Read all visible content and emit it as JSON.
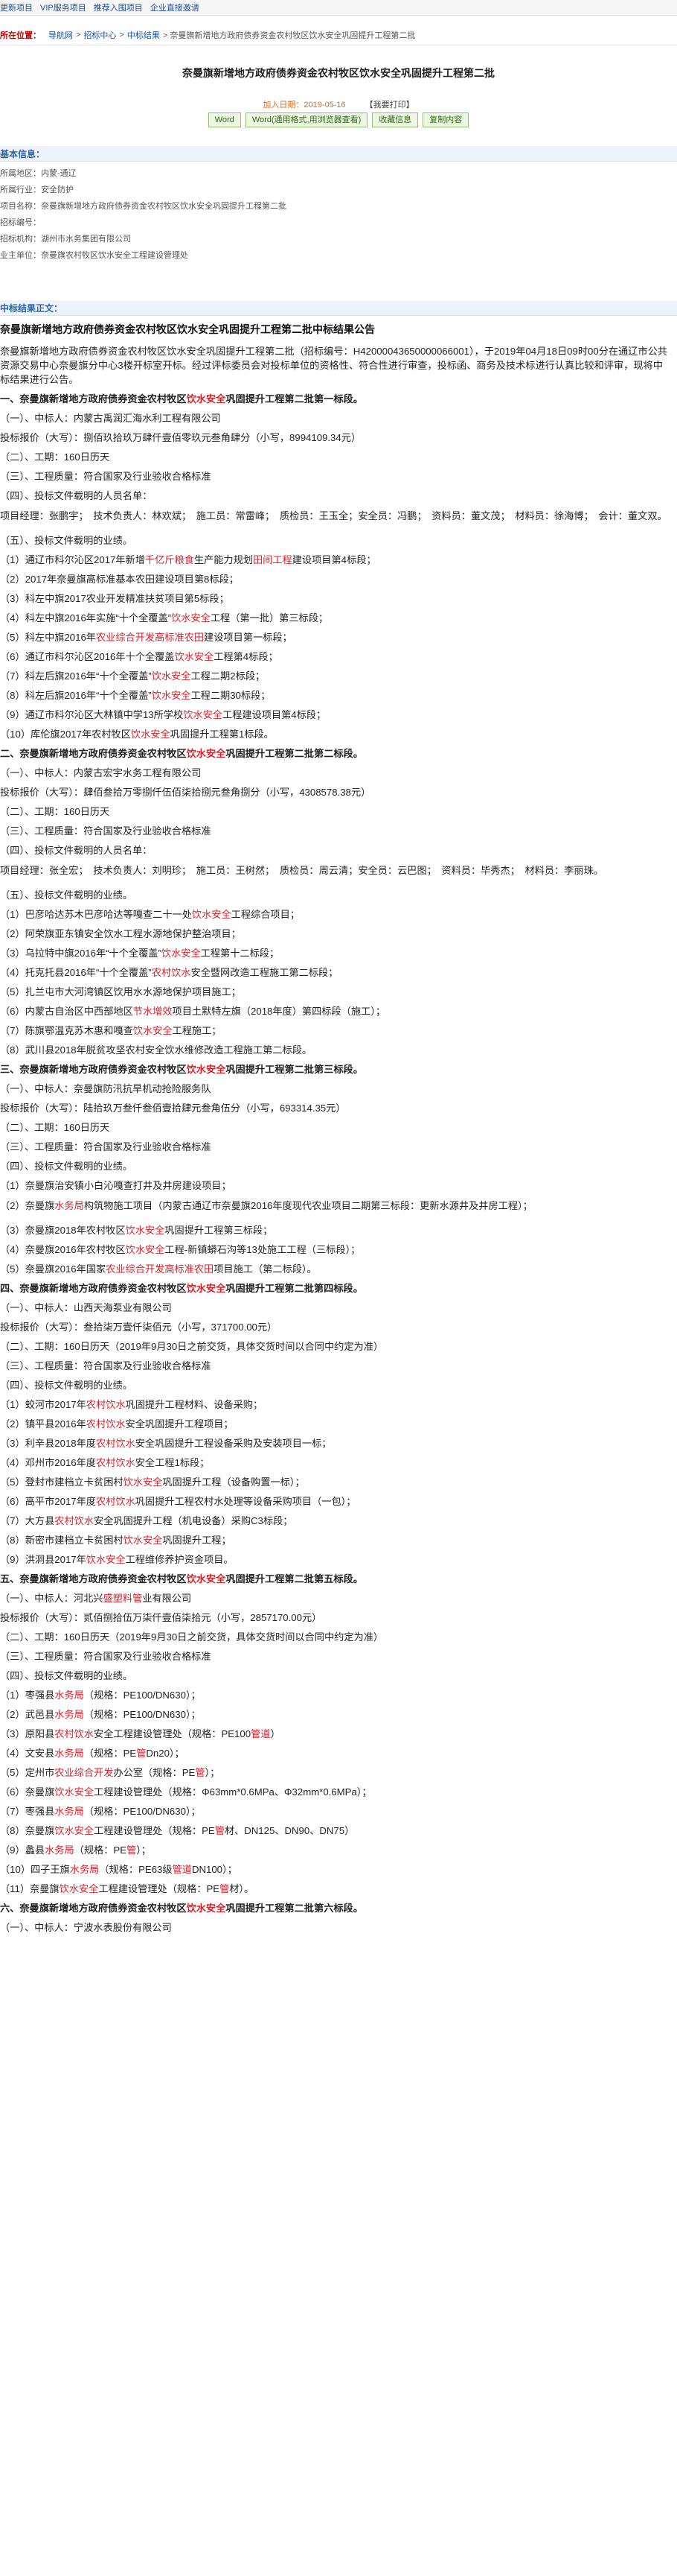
{
  "topbar": [
    "更新项目",
    "VIP服务项目",
    "推荐入围项目",
    "企业直接邀请"
  ],
  "breadcrumb": {
    "label": "所在位置：",
    "items": [
      "导航网",
      "招标中心",
      "中标结果"
    ],
    "sep": ">",
    "current": "> 奈曼旗新增地方政府债券资金农村牧区饮水安全巩固提升工程第二批"
  },
  "title": "奈曼旗新增地方政府债券资金农村牧区饮水安全巩固提升工程第二批",
  "meta": {
    "date": "加入日期：2019-05-16",
    "print": "【我要打印】"
  },
  "buttons": [
    "Word",
    "Word(通用格式,用浏览器查看)",
    "收藏信息",
    "复制内容"
  ],
  "basic_info": {
    "header": "基本信息：",
    "rows": [
      "所属地区：内蒙-通辽",
      "所属行业：安全防护",
      "项目名称：奈曼旗新增地方政府债券资金农村牧区饮水安全巩固提升工程第二批",
      "招标编号：",
      "招标机构：湖州市水务集团有限公司",
      "业主单位：奈曼旗农村牧区饮水安全工程建设管理处"
    ]
  },
  "body_header": "中标结果正文：",
  "article": {
    "title": "奈曼旗新增地方政府债券资金农村牧区饮水安全巩固提升工程第二批中标结果公告",
    "lines": [
      {
        "kind": "wrap",
        "segs": [
          "奈曼旗新增地方政府债券资金农村牧区饮水安全巩固提升工程第二批（招标编号：H42000043650000066001），于2019年04月18日09时00分在通辽市公共资源交易中心奈曼旗分中心3楼开标室开标。经过评标委员会对投标单位的资格性、符合性进行审查，投标函、商务及技术标进行认真比较和评审，现将中标结果进行公告。"
        ]
      },
      {
        "kind": "bold",
        "segs": [
          "一、奈曼旗新增地方政府债券资金农村牧区",
          "饮水安全",
          "巩固提升工程第二批第一标段。"
        ]
      },
      {
        "kind": "plain",
        "segs": [
          "（一）、中标人：内蒙古禹润汇海水利工程有限公司"
        ]
      },
      {
        "kind": "plain",
        "segs": [
          "投标报价（大写）：捌佰玖拾玖万肆仟壹佰零玖元叁角肆分（小写，8994109.34元）"
        ]
      },
      {
        "kind": "plain",
        "segs": [
          "（二）、工期：160日历天"
        ]
      },
      {
        "kind": "plain",
        "segs": [
          "（三）、工程质量：符合国家及行业验收合格标准"
        ]
      },
      {
        "kind": "plain",
        "segs": [
          "（四）、投标文件载明的人员名单："
        ]
      },
      {
        "kind": "wrap",
        "segs": [
          "项目经理：张鹏宇；　技术负责人：林欢斌；　施工员：常雷峰；　质检员：王玉全；安全员：冯鹏；　资料员：董文茂；　材料员：徐海博；　会计：董文双。"
        ]
      },
      {
        "kind": "plain",
        "segs": [
          "（五）、投标文件载明的业绩。"
        ]
      },
      {
        "kind": "plain",
        "segs": [
          "（1）通辽市科尔沁区2017年新增",
          "千亿斤粮食",
          "生产能力规划",
          "田间工程",
          "建设项目第4标段；"
        ]
      },
      {
        "kind": "plain",
        "segs": [
          "（2）2017年奈曼旗高标准基本农田建设项目第8标段；"
        ]
      },
      {
        "kind": "plain",
        "segs": [
          "（3）科左中旗2017农业开发精准扶贫项目第5标段；"
        ]
      },
      {
        "kind": "plain",
        "segs": [
          "（4）科左中旗2016年实施“十个全覆盖”",
          "饮水安全",
          "工程（第一批）第三标段；"
        ]
      },
      {
        "kind": "plain",
        "segs": [
          "（5）科左中旗2016年",
          "农业综合开发高标准农田",
          "建设项目第一标段；"
        ]
      },
      {
        "kind": "plain",
        "segs": [
          "（6）通辽市科尔沁区2016年十个全覆盖",
          "饮水安全",
          "工程第4标段；"
        ]
      },
      {
        "kind": "plain",
        "segs": [
          "（7）科左后旗2016年“十个全覆盖”",
          "饮水安全",
          "工程二期2标段；"
        ]
      },
      {
        "kind": "plain",
        "segs": [
          "（8）科左后旗2016年“十个全覆盖”",
          "饮水安全",
          "工程二期30标段；"
        ]
      },
      {
        "kind": "plain",
        "segs": [
          "（9）通辽市科尔沁区大林镇中学13所学校",
          "饮水安全",
          "工程建设项目第4标段；"
        ]
      },
      {
        "kind": "plain",
        "segs": [
          "（10）库伦旗2017年农村牧区",
          "饮水安全",
          "巩固提升工程第1标段。"
        ]
      },
      {
        "kind": "bold",
        "segs": [
          "二、奈曼旗新增地方政府债券资金农村牧区",
          "饮水安全",
          "巩固提升工程第二批第二标段。"
        ]
      },
      {
        "kind": "plain",
        "segs": [
          "（一）、中标人：内蒙古宏宇水务工程有限公司"
        ]
      },
      {
        "kind": "plain",
        "segs": [
          "投标报价（大写）：肆佰叁拾万零捌仟伍佰柒拾捌元叁角捌分（小写，4308578.38元）"
        ]
      },
      {
        "kind": "plain",
        "segs": [
          "（二）、工期：160日历天"
        ]
      },
      {
        "kind": "plain",
        "segs": [
          "（三）、工程质量：符合国家及行业验收合格标准"
        ]
      },
      {
        "kind": "plain",
        "segs": [
          "（四）、投标文件载明的人员名单："
        ]
      },
      {
        "kind": "wrap",
        "segs": [
          "项目经理：张全宏；　技术负责人：刘明珍；　施工员：王树然；　质检员：周云清；安全员：云巴图；　资料员：毕秀杰；　材料员：李丽珠。"
        ]
      },
      {
        "kind": "plain",
        "segs": [
          "（五）、投标文件载明的业绩。"
        ]
      },
      {
        "kind": "plain",
        "segs": [
          "（1）巴彦哈达苏木巴彦哈达等嘎查二十一处",
          "饮水安全",
          "工程综合项目；"
        ]
      },
      {
        "kind": "plain",
        "segs": [
          "（2）阿荣旗亚东镇安全饮水工程水源地保护整治项目；"
        ]
      },
      {
        "kind": "plain",
        "segs": [
          "（3）乌拉特中旗2016年“十个全覆盖”",
          "饮水安全",
          "工程第十二标段；"
        ]
      },
      {
        "kind": "plain",
        "segs": [
          "（4）托克托县2016年“十个全覆盖”",
          "农村饮水",
          "安全暨网改造工程施工第二标段；"
        ]
      },
      {
        "kind": "plain",
        "segs": [
          "（5）扎兰屯市大河湾镇区饮用水水源地保护项目施工；"
        ]
      },
      {
        "kind": "plain",
        "segs": [
          "（6）内蒙古自治区中西部地区",
          "节水增效",
          "项目土默特左旗（2018年度）第四标段（施工）；"
        ]
      },
      {
        "kind": "plain",
        "segs": [
          "（7）陈旗鄂温克苏木惠和嘎查",
          "饮水安全",
          "工程施工；"
        ]
      },
      {
        "kind": "plain",
        "segs": [
          "（8）武川县2018年脱贫攻坚农村安全饮水维修改造工程施工第二标段。"
        ]
      },
      {
        "kind": "bold",
        "segs": [
          "三、奈曼旗新增地方政府债券资金农村牧区",
          "饮水安全",
          "巩固提升工程第二批第三标段。"
        ]
      },
      {
        "kind": "plain",
        "segs": [
          "（一）、中标人：奈曼旗防汛抗旱机动抢险服务队"
        ]
      },
      {
        "kind": "plain",
        "segs": [
          "投标报价（大写）：陆拾玖万叁仟叁佰壹拾肆元叁角伍分（小写，693314.35元）"
        ]
      },
      {
        "kind": "plain",
        "segs": [
          "（二）、工期：160日历天"
        ]
      },
      {
        "kind": "plain",
        "segs": [
          "（三）、工程质量：符合国家及行业验收合格标准"
        ]
      },
      {
        "kind": "plain",
        "segs": [
          "（四）、投标文件载明的业绩。"
        ]
      },
      {
        "kind": "plain",
        "segs": [
          "（1）奈曼旗治安镇小白沁嘎查打井及井房建设项目；"
        ]
      },
      {
        "kind": "wrap",
        "segs": [
          "（2）奈曼旗",
          "水务局",
          "构筑物施工项目（内蒙古通辽市奈曼旗2016年度现代农业项目二期第三标段：更新水源井及井房工程）；"
        ]
      },
      {
        "kind": "plain",
        "segs": [
          "（3）奈曼旗2018年农村牧区",
          "饮水安全",
          "巩固提升工程第三标段；"
        ]
      },
      {
        "kind": "plain",
        "segs": [
          "（4）奈曼旗2016年农村牧区",
          "饮水安全",
          "工程-新镇蟒石沟等13处施工工程（三标段）；"
        ]
      },
      {
        "kind": "plain",
        "segs": [
          "（5）奈曼旗2016年国家",
          "农业综合开发高标准农田",
          "项目施工（第二标段）。"
        ]
      },
      {
        "kind": "bold",
        "segs": [
          "四、奈曼旗新增地方政府债券资金农村牧区",
          "饮水安全",
          "巩固提升工程第二批第四标段。"
        ]
      },
      {
        "kind": "plain",
        "segs": [
          "（一）、中标人：山西天海泵业有限公司"
        ]
      },
      {
        "kind": "plain",
        "segs": [
          "投标报价（大写）：叁拾柒万壹仟柒佰元（小写，371700.00元）"
        ]
      },
      {
        "kind": "plain",
        "segs": [
          "（二）、工期：160日历天（2019年9月30日之前交货，具体交货时间以合同中约定为准）"
        ]
      },
      {
        "kind": "plain",
        "segs": [
          "（三）、工程质量：符合国家及行业验收合格标准"
        ]
      },
      {
        "kind": "plain",
        "segs": [
          "（四）、投标文件载明的业绩。"
        ]
      },
      {
        "kind": "plain",
        "segs": [
          "（1）蛟河市2017年",
          "农村饮水",
          "巩固提升工程材料、设备采购；"
        ]
      },
      {
        "kind": "plain",
        "segs": [
          "（2）镇平县2016年",
          "农村饮水",
          "安全巩固提升工程项目；"
        ]
      },
      {
        "kind": "plain",
        "segs": [
          "（3）利辛县2018年度",
          "农村饮水",
          "安全巩固提升工程设备采购及安装项目一标；"
        ]
      },
      {
        "kind": "plain",
        "segs": [
          "（4）邓州市2016年度",
          "农村饮水",
          "安全工程1标段；"
        ]
      },
      {
        "kind": "plain",
        "segs": [
          "（5）登封市建档立卡贫困村",
          "饮水安全",
          "巩固提升工程（设备购置一标）；"
        ]
      },
      {
        "kind": "plain",
        "segs": [
          "（6）高平市2017年度",
          "农村饮水",
          "巩固提升工程农村水处理等设备采购项目（一包）；"
        ]
      },
      {
        "kind": "plain",
        "segs": [
          "（7）大方县",
          "农村饮水",
          "安全巩固提升工程（机电设备）采购C3标段；"
        ]
      },
      {
        "kind": "plain",
        "segs": [
          "（8）新密市建档立卡贫困村",
          "饮水安全",
          "巩固提升工程；"
        ]
      },
      {
        "kind": "plain",
        "segs": [
          "（9）洪洞县2017年",
          "饮水安全",
          "工程维修养护资金项目。"
        ]
      },
      {
        "kind": "bold",
        "segs": [
          "五、奈曼旗新增地方政府债券资金农村牧区",
          "饮水安全",
          "巩固提升工程第二批第五标段。"
        ]
      },
      {
        "kind": "plain",
        "segs": [
          "（一）、中标人：河北兴",
          "盛塑料管",
          "业有限公司"
        ]
      },
      {
        "kind": "plain",
        "segs": [
          "投标报价（大写）：贰佰捌拾伍万柒仟壹佰柒拾元（小写，2857170.00元）"
        ]
      },
      {
        "kind": "plain",
        "segs": [
          "（二）、工期：160日历天（2019年9月30日之前交货，具体交货时间以合同中约定为准）"
        ]
      },
      {
        "kind": "plain",
        "segs": [
          "（三）、工程质量：符合国家及行业验收合格标准"
        ]
      },
      {
        "kind": "plain",
        "segs": [
          "（四）、投标文件载明的业绩。"
        ]
      },
      {
        "kind": "plain",
        "segs": [
          "（1）枣强县",
          "水务局",
          "（规格：PE100/DN630）；"
        ]
      },
      {
        "kind": "plain",
        "segs": [
          "（2）武邑县",
          "水务局",
          "（规格：PE100/DN630）；"
        ]
      },
      {
        "kind": "plain",
        "segs": [
          "（3）原阳县",
          "农村饮水",
          "安全工程建设管理处（规格：PE100",
          "管道",
          "）"
        ]
      },
      {
        "kind": "plain",
        "segs": [
          "（4）文安县",
          "水务局",
          "（规格：PE",
          "管",
          "Dn20）；"
        ]
      },
      {
        "kind": "plain",
        "segs": [
          "（5）定州市",
          "农业综合开发",
          "办公室（规格：PE",
          "管",
          "）；"
        ]
      },
      {
        "kind": "plain",
        "segs": [
          "（6）奈曼旗",
          "饮水安全",
          "工程建设管理处（规格：Φ63mm*0.6MPa、Φ32mm*0.6MPa）；"
        ]
      },
      {
        "kind": "plain",
        "segs": [
          "（7）枣强县",
          "水务局",
          "（规格：PE100/DN630）；"
        ]
      },
      {
        "kind": "plain",
        "segs": [
          "（8）奈曼旗",
          "饮水安全",
          "工程建设管理处（规格：PE",
          "管",
          "材、DN125、DN90、DN75）"
        ]
      },
      {
        "kind": "plain",
        "segs": [
          "（9）蠡县",
          "水务局",
          "（规格：PE",
          "管",
          "）；"
        ]
      },
      {
        "kind": "plain",
        "segs": [
          "（10）四子王旗",
          "水务局",
          "（规格：PE63级",
          "管道",
          "DN100）；"
        ]
      },
      {
        "kind": "plain",
        "segs": [
          "（11）奈曼旗",
          "饮水安全",
          "工程建设管理处（规格：PE",
          "管",
          "材）。"
        ]
      },
      {
        "kind": "bold",
        "segs": [
          "六、奈曼旗新增地方政府债券资金农村牧区",
          "饮水安全",
          "巩固提升工程第二批第六标段。"
        ]
      },
      {
        "kind": "plain",
        "segs": [
          "（一）、中标人：宁波水表股份有限公司"
        ]
      }
    ]
  },
  "colors": {
    "link": "#1a4fa3",
    "highlight": "#d8232a",
    "section_head": "#2d62a8",
    "date": "#e06a12"
  }
}
